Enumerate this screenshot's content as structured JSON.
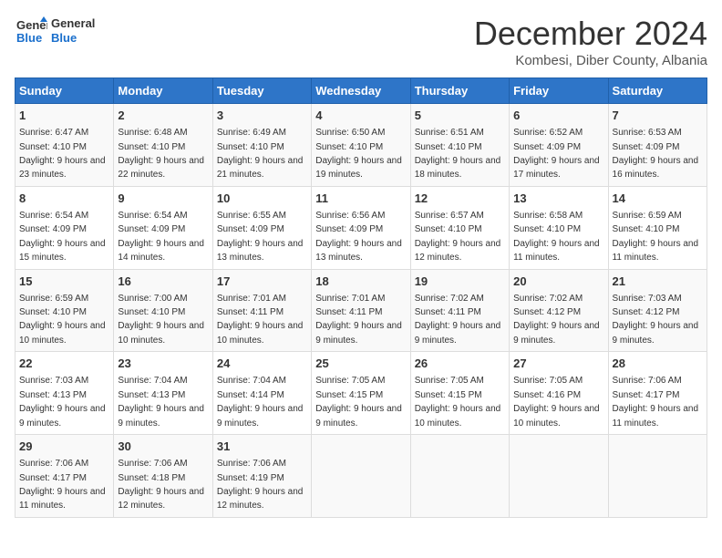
{
  "logo": {
    "line1": "General",
    "line2": "Blue"
  },
  "title": "December 2024",
  "subtitle": "Kombesi, Diber County, Albania",
  "days_of_week": [
    "Sunday",
    "Monday",
    "Tuesday",
    "Wednesday",
    "Thursday",
    "Friday",
    "Saturday"
  ],
  "weeks": [
    [
      {
        "day": 1,
        "sunrise": "6:47 AM",
        "sunset": "4:10 PM",
        "daylight": "9 hours and 23 minutes."
      },
      {
        "day": 2,
        "sunrise": "6:48 AM",
        "sunset": "4:10 PM",
        "daylight": "9 hours and 22 minutes."
      },
      {
        "day": 3,
        "sunrise": "6:49 AM",
        "sunset": "4:10 PM",
        "daylight": "9 hours and 21 minutes."
      },
      {
        "day": 4,
        "sunrise": "6:50 AM",
        "sunset": "4:10 PM",
        "daylight": "9 hours and 19 minutes."
      },
      {
        "day": 5,
        "sunrise": "6:51 AM",
        "sunset": "4:10 PM",
        "daylight": "9 hours and 18 minutes."
      },
      {
        "day": 6,
        "sunrise": "6:52 AM",
        "sunset": "4:09 PM",
        "daylight": "9 hours and 17 minutes."
      },
      {
        "day": 7,
        "sunrise": "6:53 AM",
        "sunset": "4:09 PM",
        "daylight": "9 hours and 16 minutes."
      }
    ],
    [
      {
        "day": 8,
        "sunrise": "6:54 AM",
        "sunset": "4:09 PM",
        "daylight": "9 hours and 15 minutes."
      },
      {
        "day": 9,
        "sunrise": "6:54 AM",
        "sunset": "4:09 PM",
        "daylight": "9 hours and 14 minutes."
      },
      {
        "day": 10,
        "sunrise": "6:55 AM",
        "sunset": "4:09 PM",
        "daylight": "9 hours and 13 minutes."
      },
      {
        "day": 11,
        "sunrise": "6:56 AM",
        "sunset": "4:09 PM",
        "daylight": "9 hours and 13 minutes."
      },
      {
        "day": 12,
        "sunrise": "6:57 AM",
        "sunset": "4:10 PM",
        "daylight": "9 hours and 12 minutes."
      },
      {
        "day": 13,
        "sunrise": "6:58 AM",
        "sunset": "4:10 PM",
        "daylight": "9 hours and 11 minutes."
      },
      {
        "day": 14,
        "sunrise": "6:59 AM",
        "sunset": "4:10 PM",
        "daylight": "9 hours and 11 minutes."
      }
    ],
    [
      {
        "day": 15,
        "sunrise": "6:59 AM",
        "sunset": "4:10 PM",
        "daylight": "9 hours and 10 minutes."
      },
      {
        "day": 16,
        "sunrise": "7:00 AM",
        "sunset": "4:10 PM",
        "daylight": "9 hours and 10 minutes."
      },
      {
        "day": 17,
        "sunrise": "7:01 AM",
        "sunset": "4:11 PM",
        "daylight": "9 hours and 10 minutes."
      },
      {
        "day": 18,
        "sunrise": "7:01 AM",
        "sunset": "4:11 PM",
        "daylight": "9 hours and 9 minutes."
      },
      {
        "day": 19,
        "sunrise": "7:02 AM",
        "sunset": "4:11 PM",
        "daylight": "9 hours and 9 minutes."
      },
      {
        "day": 20,
        "sunrise": "7:02 AM",
        "sunset": "4:12 PM",
        "daylight": "9 hours and 9 minutes."
      },
      {
        "day": 21,
        "sunrise": "7:03 AM",
        "sunset": "4:12 PM",
        "daylight": "9 hours and 9 minutes."
      }
    ],
    [
      {
        "day": 22,
        "sunrise": "7:03 AM",
        "sunset": "4:13 PM",
        "daylight": "9 hours and 9 minutes."
      },
      {
        "day": 23,
        "sunrise": "7:04 AM",
        "sunset": "4:13 PM",
        "daylight": "9 hours and 9 minutes."
      },
      {
        "day": 24,
        "sunrise": "7:04 AM",
        "sunset": "4:14 PM",
        "daylight": "9 hours and 9 minutes."
      },
      {
        "day": 25,
        "sunrise": "7:05 AM",
        "sunset": "4:15 PM",
        "daylight": "9 hours and 9 minutes."
      },
      {
        "day": 26,
        "sunrise": "7:05 AM",
        "sunset": "4:15 PM",
        "daylight": "9 hours and 10 minutes."
      },
      {
        "day": 27,
        "sunrise": "7:05 AM",
        "sunset": "4:16 PM",
        "daylight": "9 hours and 10 minutes."
      },
      {
        "day": 28,
        "sunrise": "7:06 AM",
        "sunset": "4:17 PM",
        "daylight": "9 hours and 11 minutes."
      }
    ],
    [
      {
        "day": 29,
        "sunrise": "7:06 AM",
        "sunset": "4:17 PM",
        "daylight": "9 hours and 11 minutes."
      },
      {
        "day": 30,
        "sunrise": "7:06 AM",
        "sunset": "4:18 PM",
        "daylight": "9 hours and 12 minutes."
      },
      {
        "day": 31,
        "sunrise": "7:06 AM",
        "sunset": "4:19 PM",
        "daylight": "9 hours and 12 minutes."
      },
      null,
      null,
      null,
      null
    ]
  ]
}
